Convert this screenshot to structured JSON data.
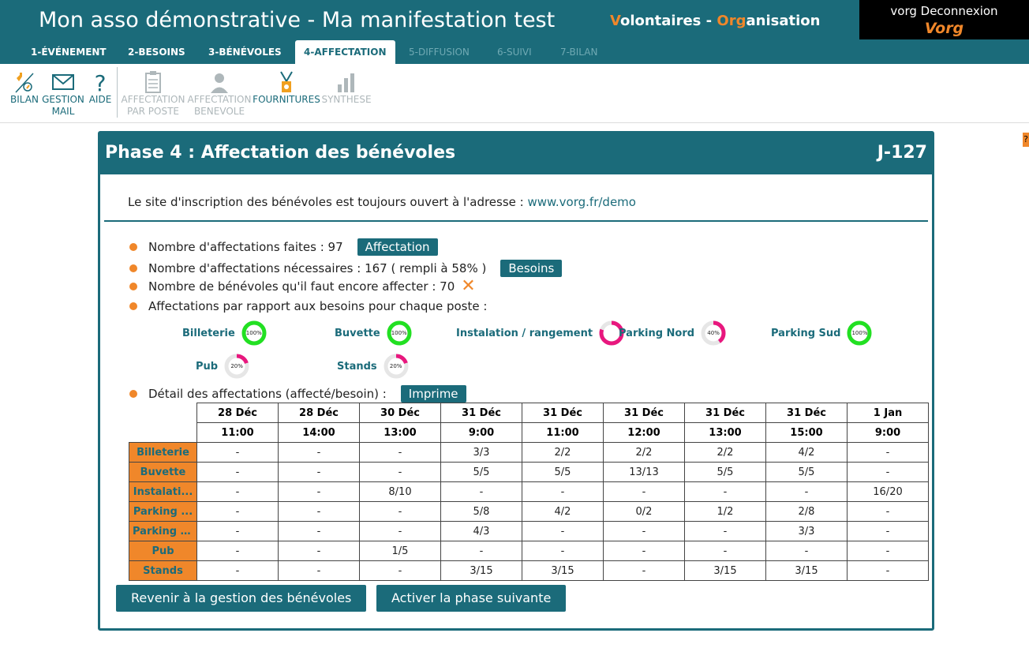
{
  "header": {
    "title": "Mon asso démonstrative - Ma manifestation test",
    "brand": [
      {
        "t": "V",
        "accent": true
      },
      {
        "t": "olontaires - ",
        "accent": false
      },
      {
        "t": "Org",
        "accent": true
      },
      {
        "t": "anisation",
        "accent": false
      }
    ],
    "user_line": "vorg Deconnexion",
    "logo": "Vorg"
  },
  "tabs": [
    {
      "label": "1-ÉVÉNEMENT",
      "state": "normal"
    },
    {
      "label": "2-BESOINS",
      "state": "normal"
    },
    {
      "label": "3-BÉNÉVOLES",
      "state": "normal"
    },
    {
      "label": "4-AFFECTATION",
      "state": "active"
    },
    {
      "label": "5-DIFFUSION",
      "state": "disabled"
    },
    {
      "label": "6-SUIVI",
      "state": "disabled"
    },
    {
      "label": "7-BILAN",
      "state": "disabled"
    }
  ],
  "toolbar": [
    {
      "label": "BILAN",
      "icon": "bilan-icon",
      "enabled": true
    },
    {
      "label": "GESTION\nMAIL",
      "icon": "mail-icon",
      "enabled": true
    },
    {
      "label": "AIDE",
      "icon": "help-icon",
      "enabled": true
    },
    {
      "label": "AFFECTATION\nPAR POSTE",
      "icon": "clipboard-icon",
      "enabled": false
    },
    {
      "label": "AFFECTATION\nBENEVOLE",
      "icon": "person-icon",
      "enabled": false
    },
    {
      "label": "FOURNITURES",
      "icon": "badge-icon",
      "enabled": true
    },
    {
      "label": "SYNTHESE",
      "icon": "bar-chart-icon",
      "enabled": false
    }
  ],
  "help_chip": "?",
  "colors": {
    "primary": "#1b6b7a",
    "accent": "#f0872a",
    "donut_full": "#22e022",
    "donut_partial": "#e8177e"
  },
  "panel": {
    "title": "Phase 4 : Affectation des bénévoles",
    "days": "J-127",
    "site_prefix": "Le site d'inscription des bénévoles est toujours ouvert à l'adresse : ",
    "site_url": "www.vorg.fr/demo"
  },
  "stats": {
    "done": "Nombre d'affectations faites : 97",
    "done_btn": "Affectation",
    "needed": "Nombre d'affectations nécessaires : 167 ( rempli à 58% )",
    "needed_btn": "Besoins",
    "remaining": "Nombre de bénévoles qu'il faut encore affecter : 70",
    "remaining_icon": "close-icon",
    "per_poste": "Affectations par rapport aux besoins pour chaque poste :",
    "detail": "Détail des affectations (affecté/besoin) :",
    "detail_btn": "Imprime"
  },
  "postes": [
    {
      "name": "Billeterie",
      "label": "100%",
      "fraction": 1.0
    },
    {
      "name": "Buvette",
      "label": "100%",
      "fraction": 1.0
    },
    {
      "name": "Instalation / rangement",
      "label": "",
      "fraction": 0.8
    },
    {
      "name": "Parking Nord",
      "label": "40%",
      "fraction": 0.4
    },
    {
      "name": "Parking Sud",
      "label": "100%",
      "fraction": 1.0
    },
    {
      "name": "Pub",
      "label": "20%",
      "fraction": 0.2
    },
    {
      "name": "Stands",
      "label": "20%",
      "fraction": 0.2
    }
  ],
  "table": {
    "dates": [
      "28 Déc",
      "28 Déc",
      "30 Déc",
      "31 Déc",
      "31 Déc",
      "31 Déc",
      "31 Déc",
      "31 Déc",
      "1 Jan"
    ],
    "times": [
      "11:00",
      "14:00",
      "13:00",
      "9:00",
      "11:00",
      "12:00",
      "13:00",
      "15:00",
      "9:00"
    ],
    "rows": [
      {
        "name": "Billeterie",
        "cells": [
          "-",
          "-",
          "-",
          "3/3",
          "2/2",
          "2/2",
          "2/2",
          "4/2",
          "-"
        ]
      },
      {
        "name": "Buvette",
        "cells": [
          "-",
          "-",
          "-",
          "5/5",
          "5/5",
          "13/13",
          "5/5",
          "5/5",
          "-"
        ]
      },
      {
        "name": "Instalati...",
        "cells": [
          "-",
          "-",
          "8/10",
          "-",
          "-",
          "-",
          "-",
          "-",
          "16/20"
        ]
      },
      {
        "name": "Parking ...",
        "cells": [
          "-",
          "-",
          "-",
          "5/8",
          "4/2",
          "0/2",
          "1/2",
          "2/8",
          "-"
        ]
      },
      {
        "name": "Parking S...",
        "cells": [
          "-",
          "-",
          "-",
          "4/3",
          "-",
          "-",
          "-",
          "3/3",
          "-"
        ]
      },
      {
        "name": "Pub",
        "cells": [
          "-",
          "-",
          "1/5",
          "-",
          "-",
          "-",
          "-",
          "-",
          "-"
        ]
      },
      {
        "name": "Stands",
        "cells": [
          "-",
          "-",
          "-",
          "3/15",
          "3/15",
          "-",
          "3/15",
          "3/15",
          "-"
        ]
      }
    ]
  },
  "footer": {
    "back_btn": "Revenir à la gestion des bénévoles",
    "next_btn": "Activer la phase suivante"
  }
}
